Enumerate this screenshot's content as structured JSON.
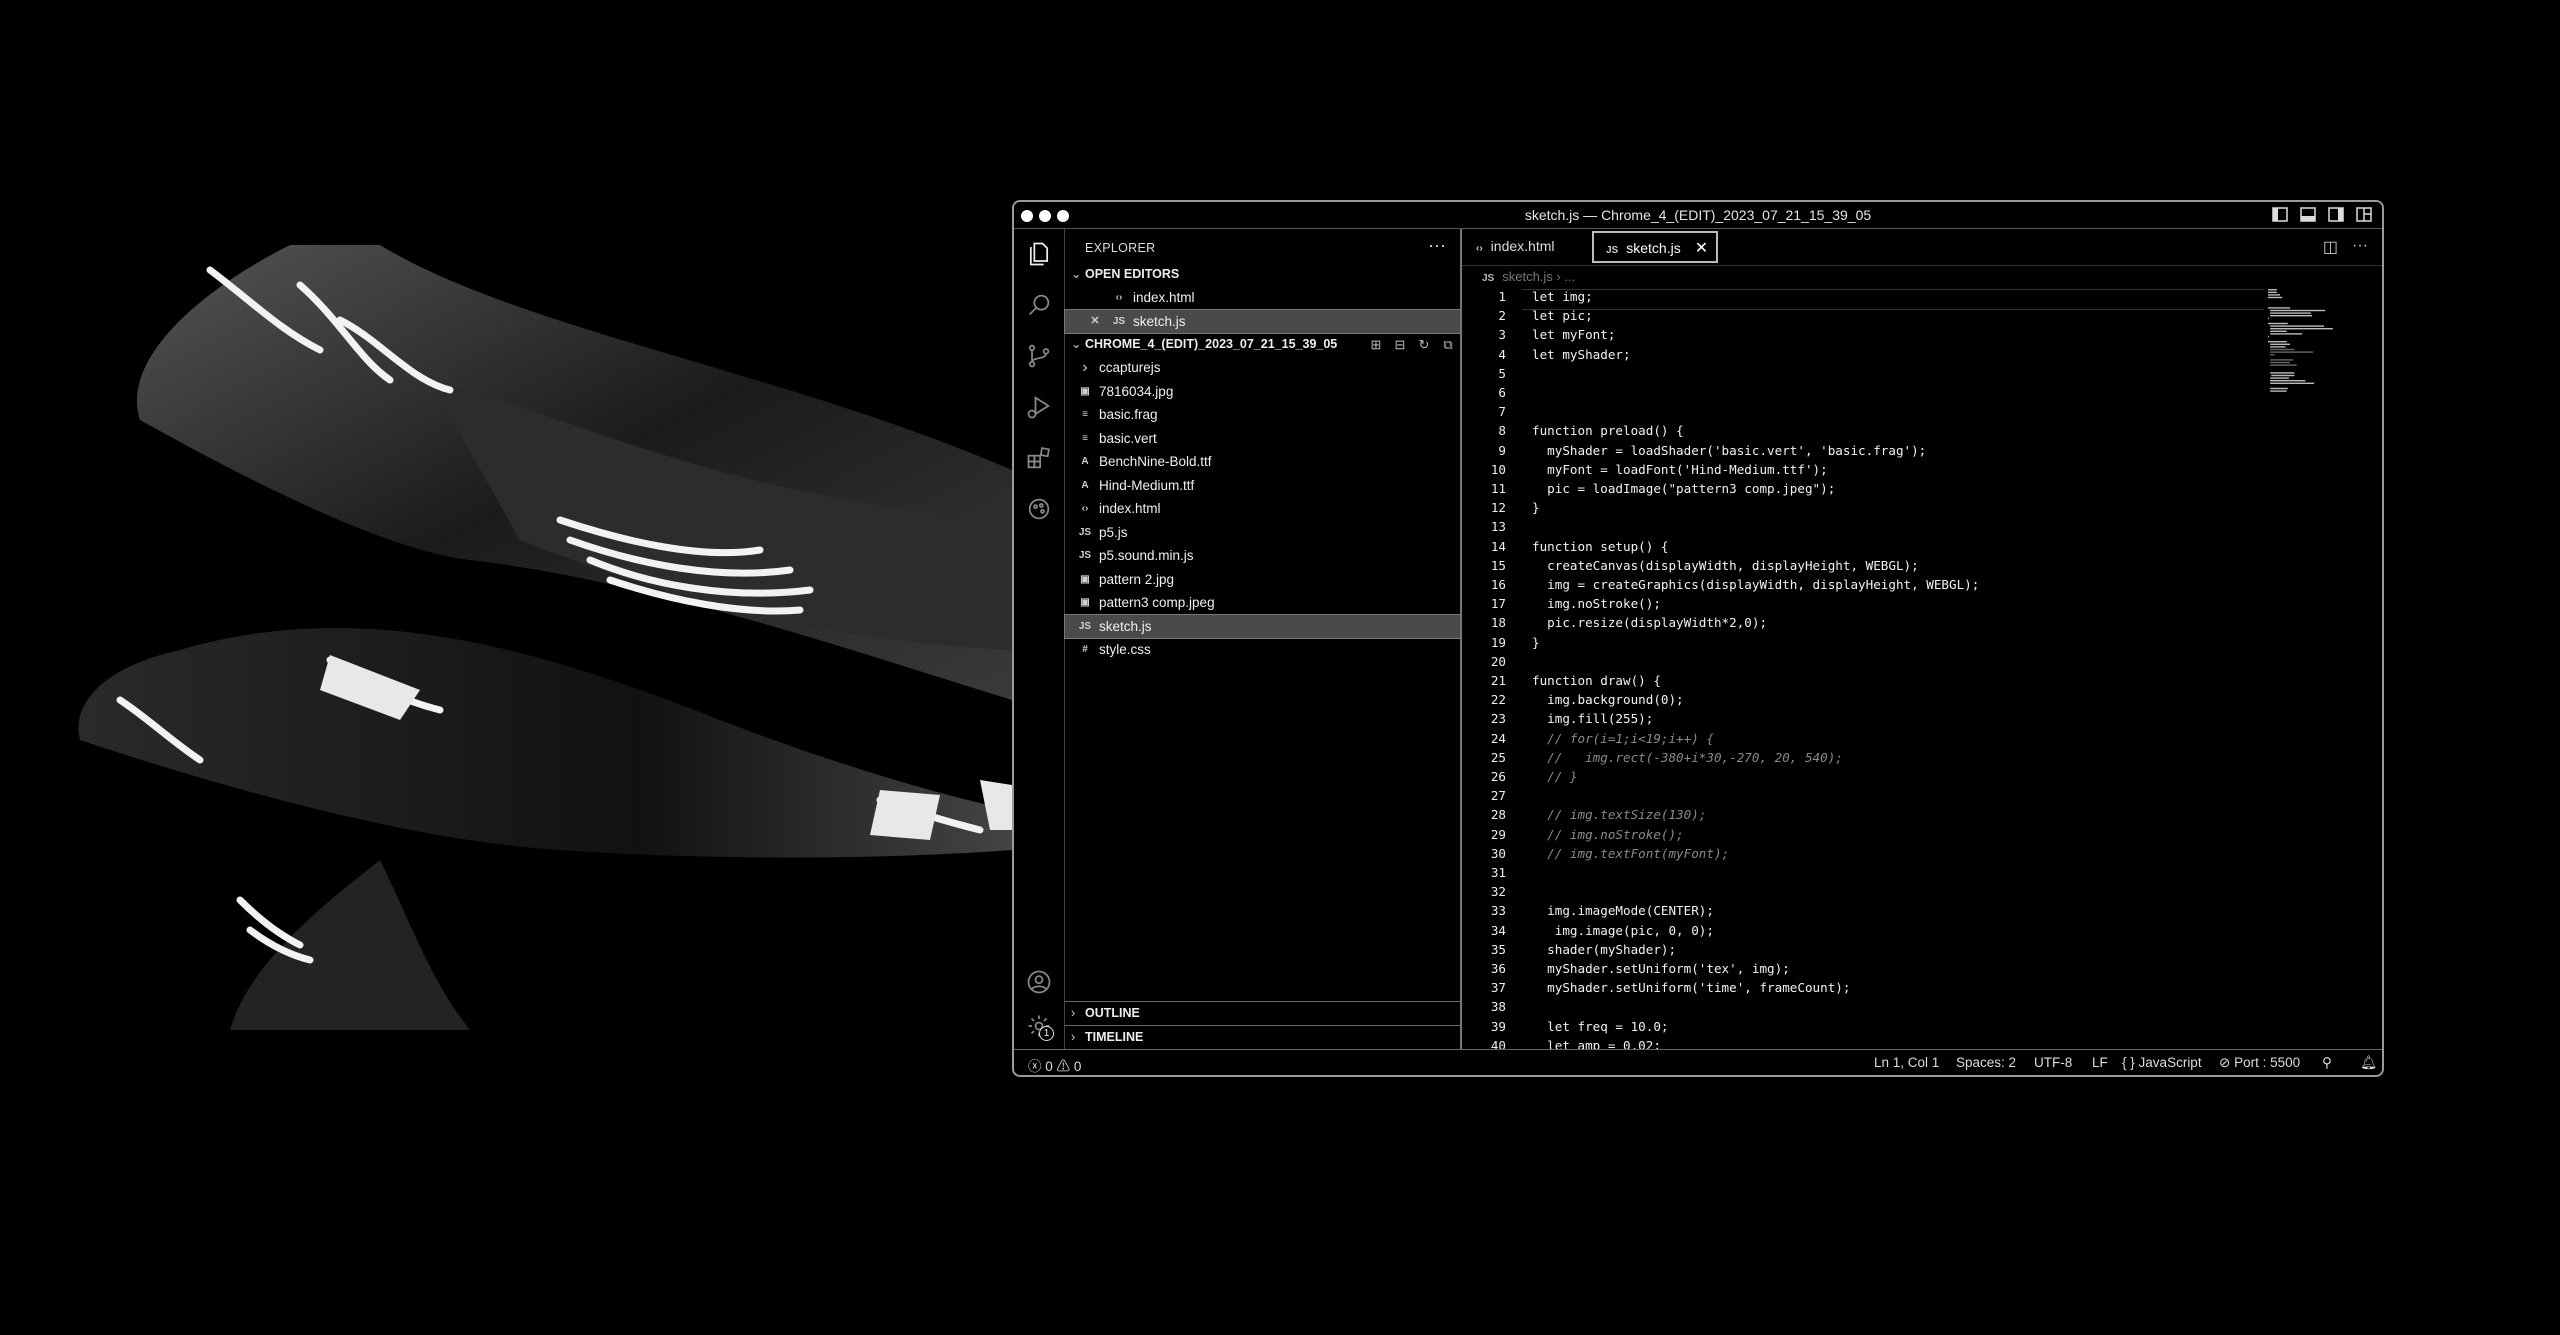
{
  "window": {
    "title": "sketch.js — Chrome_4_(EDIT)_2023_07_21_15_39_05"
  },
  "activity_bar": {
    "items": [
      "files-icon",
      "search-icon",
      "source-control-icon",
      "run-debug-icon",
      "extensions-icon",
      "live-share-icon"
    ],
    "bottom": [
      "account-icon",
      "manage-gear-icon"
    ],
    "manage_badge": "1"
  },
  "sidebar": {
    "title": "EXPLORER",
    "more": "···",
    "open_editors": {
      "label": "OPEN EDITORS",
      "items": [
        {
          "name": "index.html",
          "icon": "‹›"
        },
        {
          "name": "sketch.js",
          "icon": "JS",
          "close": "✕"
        }
      ]
    },
    "folder": {
      "label": "CHROME_4_(EDIT)_2023_07_21_15_39_05",
      "items": [
        {
          "name": "ccapturejs",
          "icon": "›"
        },
        {
          "name": "7816034.jpg",
          "icon": "▣"
        },
        {
          "name": "basic.frag",
          "icon": "≡"
        },
        {
          "name": "basic.vert",
          "icon": "≡"
        },
        {
          "name": "BenchNine-Bold.ttf",
          "icon": "A"
        },
        {
          "name": "Hind-Medium.ttf",
          "icon": "A"
        },
        {
          "name": "index.html",
          "icon": "‹›"
        },
        {
          "name": "p5.js",
          "icon": "JS"
        },
        {
          "name": "p5.sound.min.js",
          "icon": "JS"
        },
        {
          "name": "pattern 2.jpg",
          "icon": "▣"
        },
        {
          "name": "pattern3 comp.jpeg",
          "icon": "▣"
        },
        {
          "name": "sketch.js",
          "icon": "JS"
        },
        {
          "name": "style.css",
          "icon": "#"
        }
      ]
    },
    "outline_label": "OUTLINE",
    "timeline_label": "TIMELINE"
  },
  "editor": {
    "tabs": [
      {
        "label": "index.html",
        "icon": "‹›"
      },
      {
        "label": "sketch.js",
        "icon": "JS",
        "close": "✕"
      }
    ],
    "breadcrumb": "sketch.js › ...",
    "breadcrumb_icon": "JS",
    "lines": [
      "let img;",
      "let pic;",
      "let myFont;",
      "let myShader;",
      "",
      "",
      "",
      "function preload() {",
      "  myShader = loadShader('basic.vert', 'basic.frag');",
      "  myFont = loadFont('Hind-Medium.ttf');",
      "  pic = loadImage(\"pattern3 comp.jpeg\");",
      "}",
      "",
      "function setup() {",
      "  createCanvas(displayWidth, displayHeight, WEBGL);",
      "  img = createGraphics(displayWidth, displayHeight, WEBGL);",
      "  img.noStroke();",
      "  pic.resize(displayWidth*2,0);",
      "}",
      "",
      "function draw() {",
      "  img.background(0);",
      "  img.fill(255);",
      "  // for(i=1;i<19;i++) {",
      "  //   img.rect(-380+i*30,-270, 20, 540);",
      "  // }",
      "",
      "  // img.textSize(130);",
      "  // img.noStroke();",
      "  // img.textFont(myFont);",
      "",
      "",
      "  img.imageMode(CENTER);",
      "   img.image(pic, 0, 0);",
      "  shader(myShader);",
      "  myShader.setUniform('tex', img);",
      "  myShader.setUniform('time', frameCount);",
      "",
      "  let freq = 10.0;",
      "  let amp = 0.02;"
    ]
  },
  "status_bar": {
    "errors": "0",
    "warnings": "0",
    "position": "Ln 1, Col 1",
    "spaces": "Spaces: 2",
    "encoding": "UTF-8",
    "eol": "LF",
    "language": "JavaScript",
    "port": "Port : 5500"
  }
}
